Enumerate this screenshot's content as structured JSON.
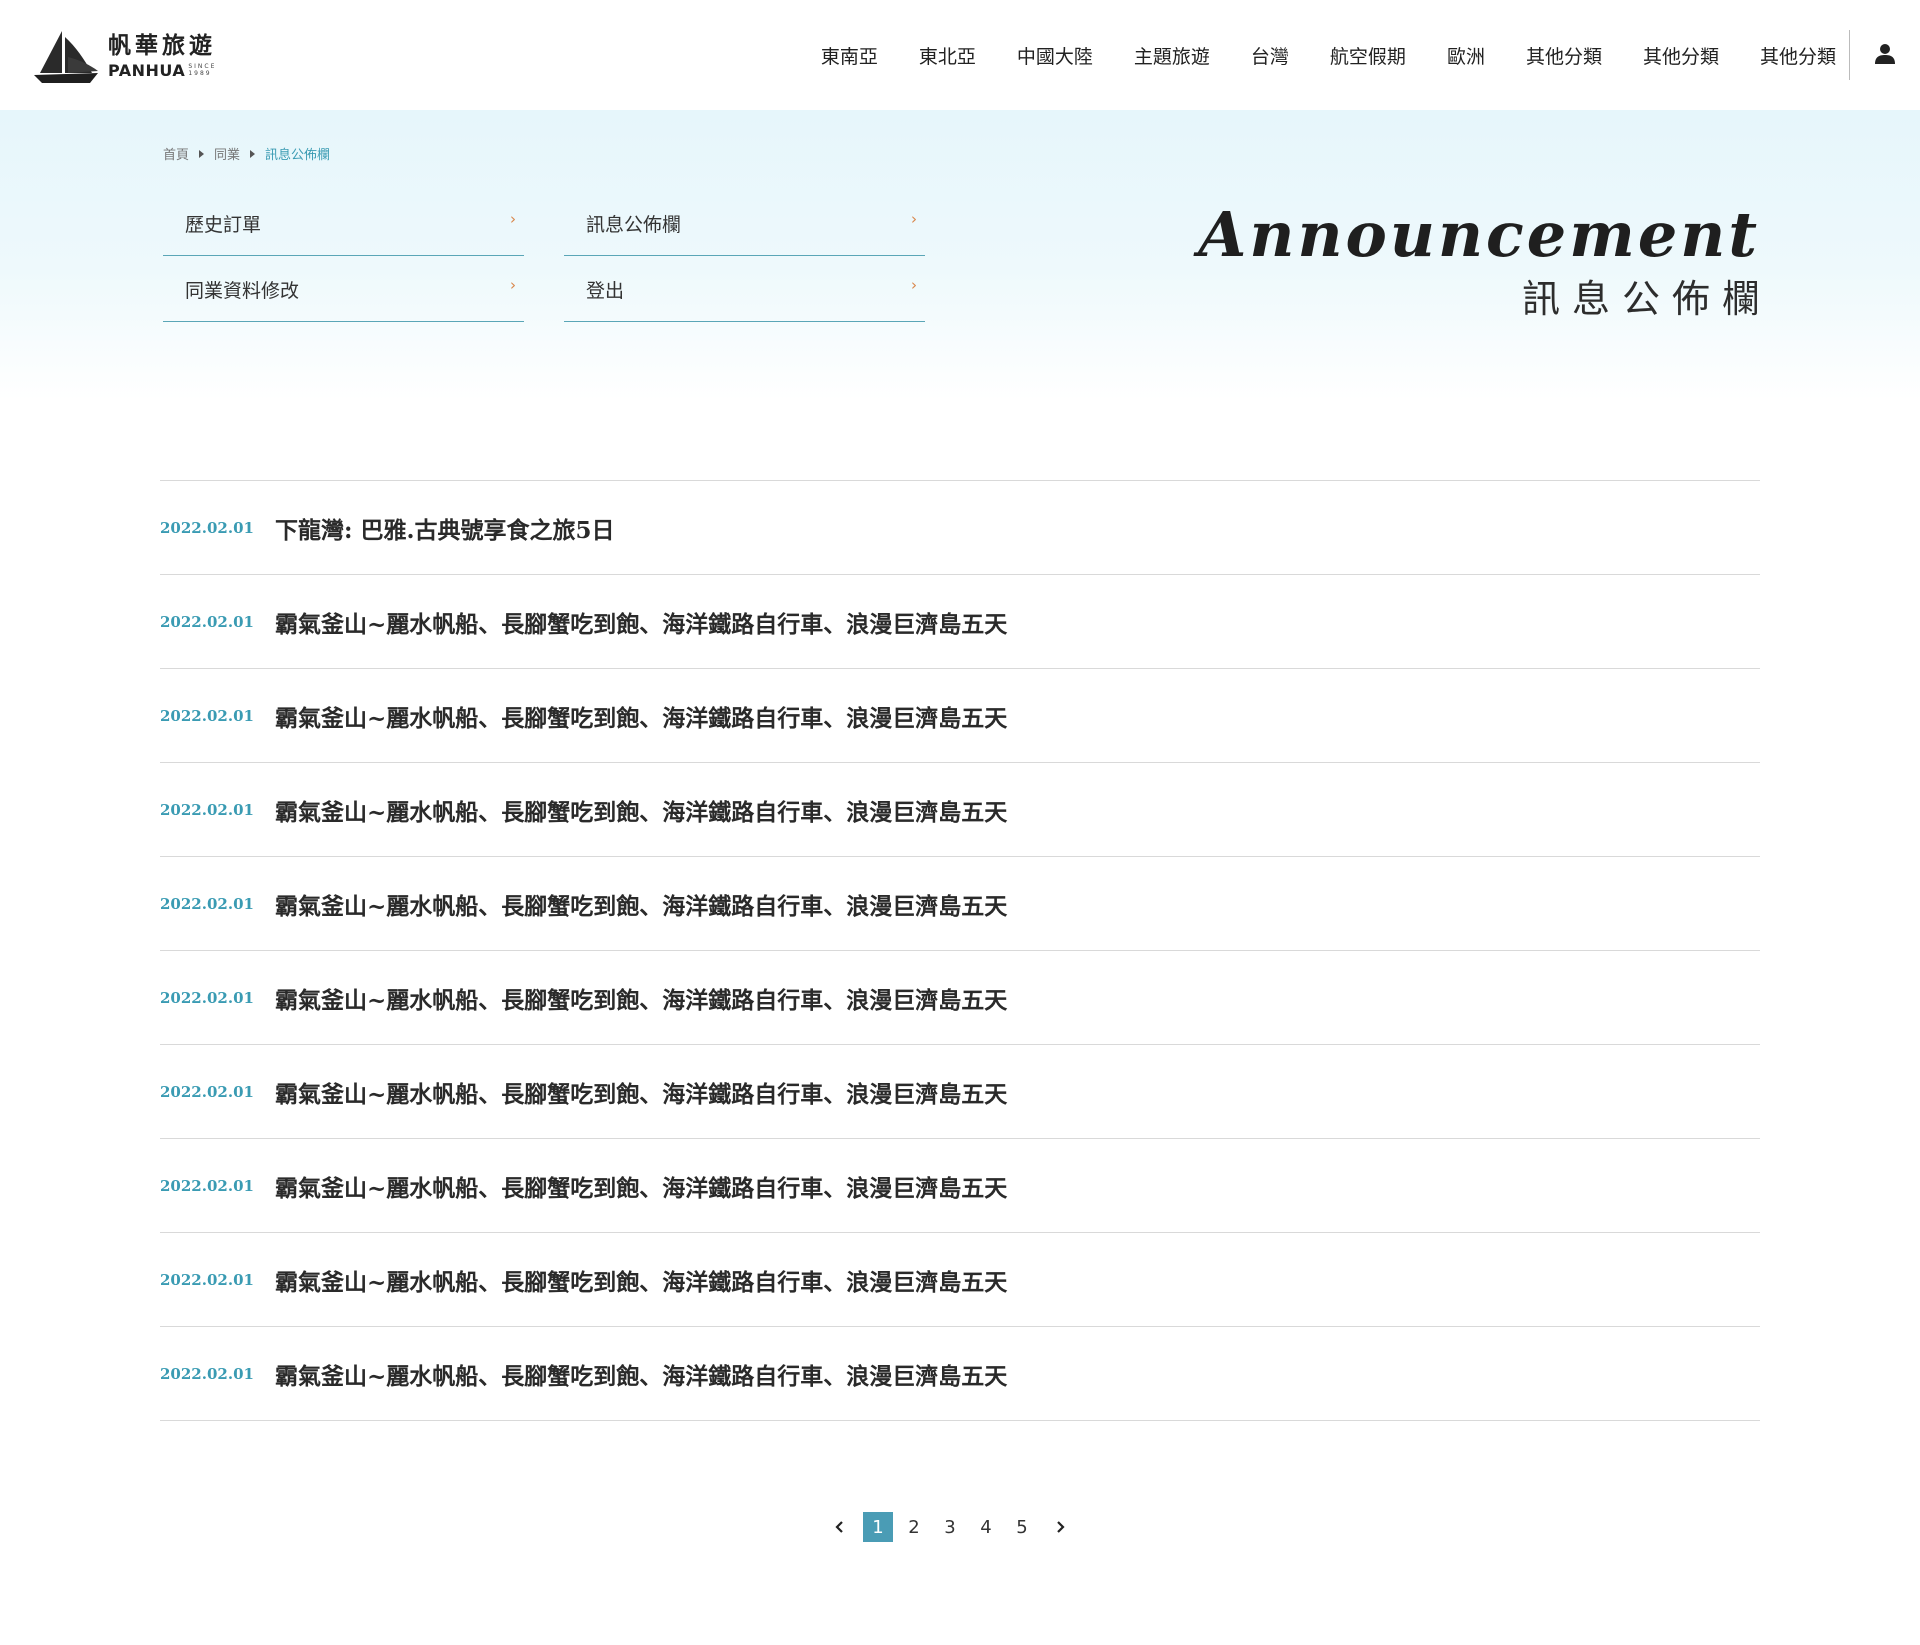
{
  "brand": {
    "name_cn": "帆華旅遊",
    "name_en": "PANHUA",
    "since_label": "SINCE",
    "since_year": "1989"
  },
  "nav": {
    "items": [
      "東南亞",
      "東北亞",
      "中國大陸",
      "主題旅遊",
      "台灣",
      "航空假期",
      "歐洲",
      "其他分類",
      "其他分類",
      "其他分類"
    ]
  },
  "breadcrumb": {
    "items": [
      "首頁",
      "同業",
      "訊息公佈欄"
    ]
  },
  "side_menu": {
    "items": [
      {
        "label": "歷史訂單",
        "arrow": "›"
      },
      {
        "label": "訊息公佈欄",
        "arrow": "›"
      },
      {
        "label": "同業資料修改",
        "arrow": "›"
      },
      {
        "label": "登出",
        "arrow": "›"
      }
    ]
  },
  "hero": {
    "title_en": "Announcement",
    "title_cn": "訊息公佈欄"
  },
  "announcements": [
    {
      "date": "2022.02.01",
      "title": "下龍灣: 巴雅.古典號享食之旅5日"
    },
    {
      "date": "2022.02.01",
      "title": "霸氣釜山~麗水帆船、長腳蟹吃到飽、海洋鐵路自行車、浪漫巨濟島五天"
    },
    {
      "date": "2022.02.01",
      "title": "霸氣釜山~麗水帆船、長腳蟹吃到飽、海洋鐵路自行車、浪漫巨濟島五天"
    },
    {
      "date": "2022.02.01",
      "title": "霸氣釜山~麗水帆船、長腳蟹吃到飽、海洋鐵路自行車、浪漫巨濟島五天"
    },
    {
      "date": "2022.02.01",
      "title": "霸氣釜山~麗水帆船、長腳蟹吃到飽、海洋鐵路自行車、浪漫巨濟島五天"
    },
    {
      "date": "2022.02.01",
      "title": "霸氣釜山~麗水帆船、長腳蟹吃到飽、海洋鐵路自行車、浪漫巨濟島五天"
    },
    {
      "date": "2022.02.01",
      "title": "霸氣釜山~麗水帆船、長腳蟹吃到飽、海洋鐵路自行車、浪漫巨濟島五天"
    },
    {
      "date": "2022.02.01",
      "title": "霸氣釜山~麗水帆船、長腳蟹吃到飽、海洋鐵路自行車、浪漫巨濟島五天"
    },
    {
      "date": "2022.02.01",
      "title": "霸氣釜山~麗水帆船、長腳蟹吃到飽、海洋鐵路自行車、浪漫巨濟島五天"
    },
    {
      "date": "2022.02.01",
      "title": "霸氣釜山~麗水帆船、長腳蟹吃到飽、海洋鐵路自行車、浪漫巨濟島五天"
    }
  ],
  "pagination": {
    "pages": [
      "1",
      "2",
      "3",
      "4",
      "5"
    ],
    "current": "1"
  },
  "colors": {
    "accent": "#3a9bb3",
    "active_page_bg": "#4a9cb5",
    "menu_arrow": "#d9864a",
    "hero_bg": "#e6f6fb"
  },
  "icons": {
    "user": "user-icon",
    "prev": "chevron-left-icon",
    "next": "chevron-right-icon",
    "breadcrumb_separator": "caret-right-icon"
  }
}
